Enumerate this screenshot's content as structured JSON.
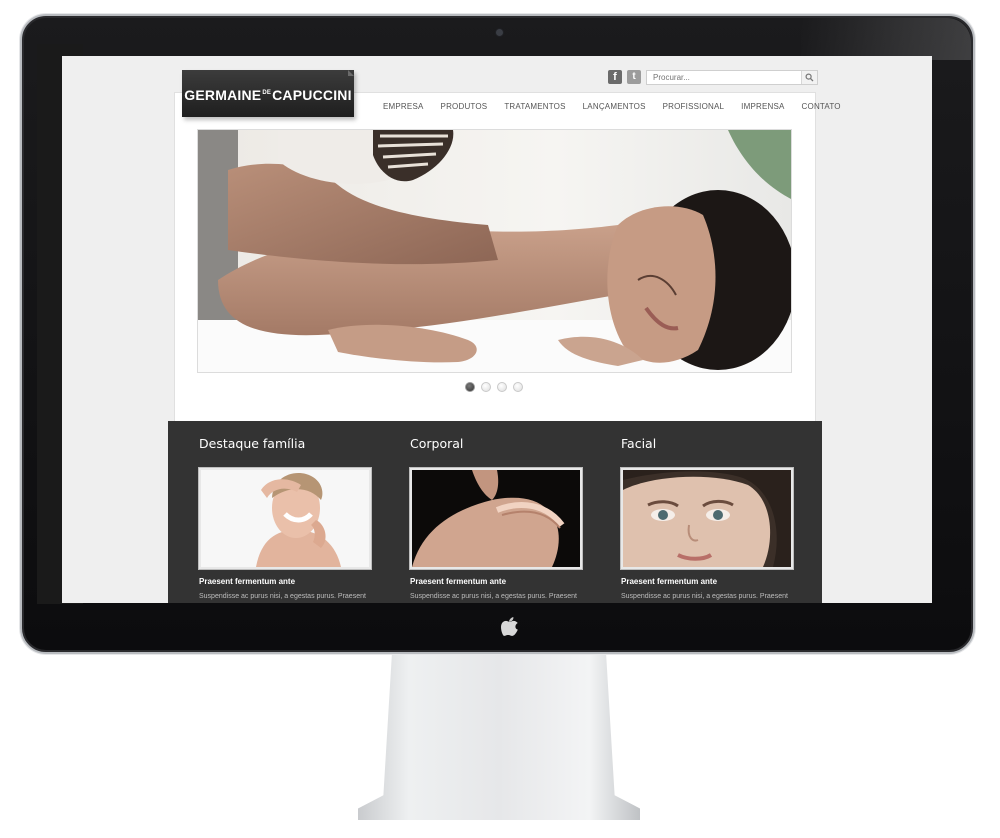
{
  "brand": {
    "logo_main": "GERMAINE",
    "logo_small": "DE",
    "logo_end": "CAPUCCINI"
  },
  "social": {
    "facebook_icon": "facebook-icon",
    "twitter_icon": "twitter-icon",
    "facebook_glyph": "f",
    "twitter_glyph": "t"
  },
  "search": {
    "placeholder": "Procurar...",
    "button_icon": "search-icon"
  },
  "nav": {
    "items": [
      {
        "label": "EMPRESA"
      },
      {
        "label": "PRODUTOS"
      },
      {
        "label": "TRATAMENTOS"
      },
      {
        "label": "LANÇAMENTOS"
      },
      {
        "label": "PROFISSIONAL"
      },
      {
        "label": "IMPRENSA"
      },
      {
        "label": "CONTATO"
      }
    ]
  },
  "slider": {
    "slide_count": 4,
    "active_slide": 1
  },
  "features": [
    {
      "title": "Destaque família",
      "heading": "Praesent fermentum ante",
      "text": "Suspendisse ac purus nisi, a egestas purus. Praesent"
    },
    {
      "title": "Corporal",
      "heading": "Praesent fermentum ante",
      "text": "Suspendisse ac purus nisi, a egestas purus. Praesent"
    },
    {
      "title": "Facial",
      "heading": "Praesent fermentum ante",
      "text": "Suspendisse ac purus nisi, a egestas purus. Praesent"
    }
  ],
  "colors": {
    "feature_band": "#333333",
    "logo_bg": "#2a2a2a",
    "screen_bg": "#efefef"
  },
  "device": {
    "logo": "apple-logo"
  }
}
